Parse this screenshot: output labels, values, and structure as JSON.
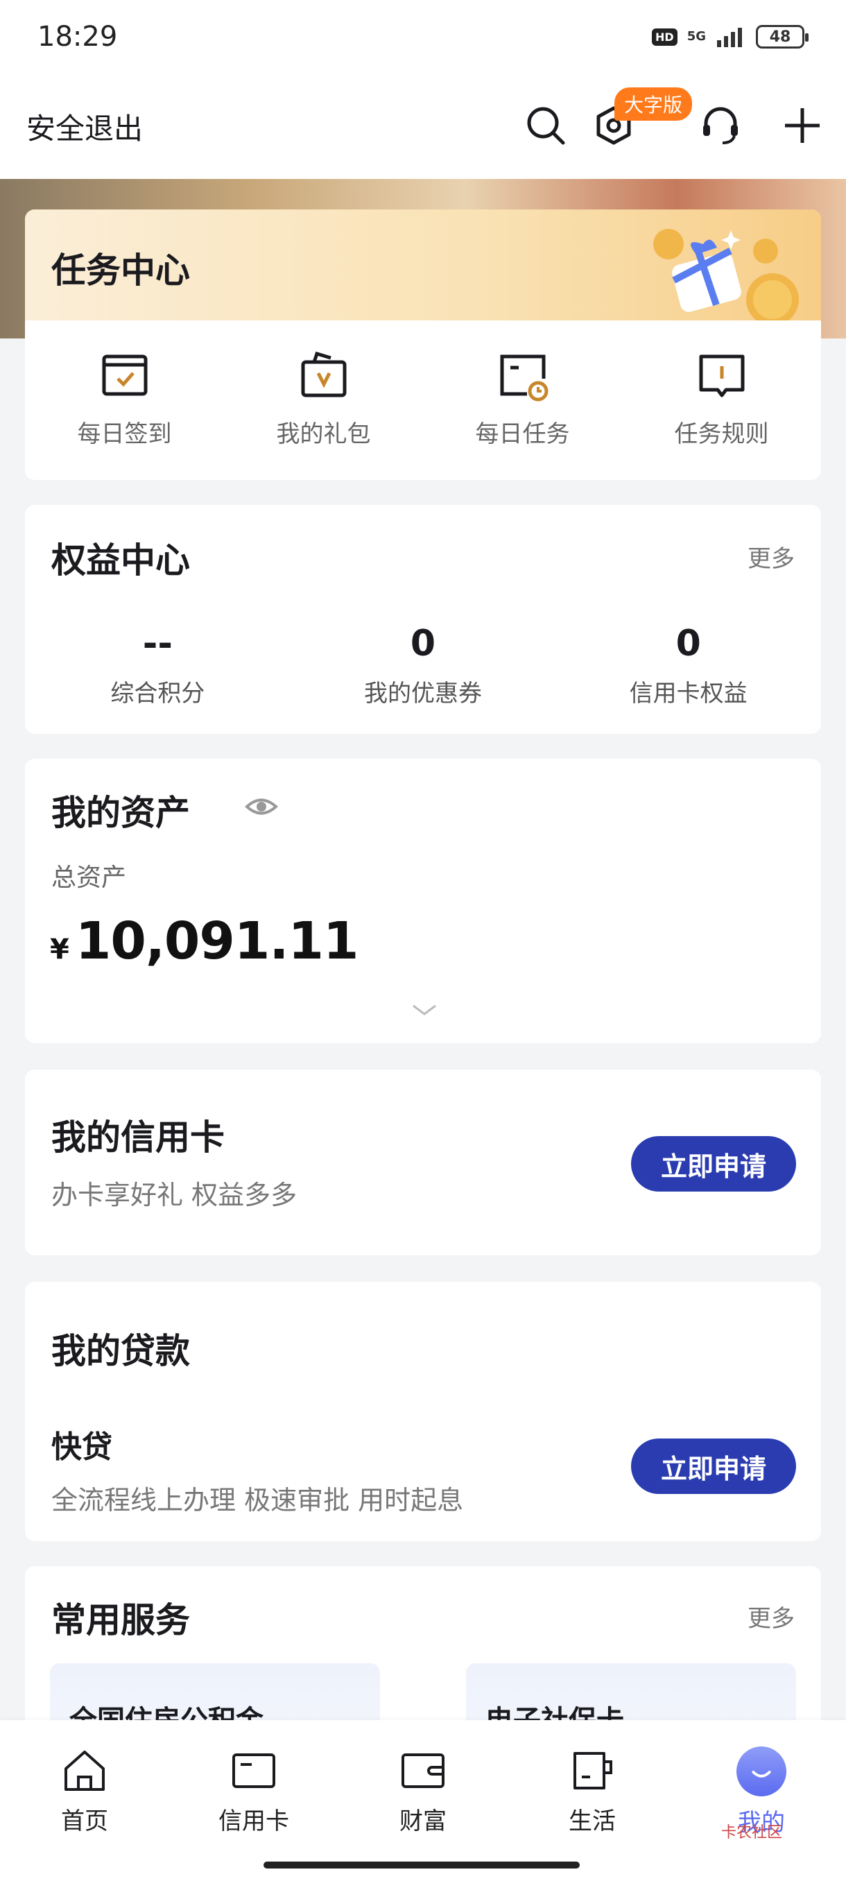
{
  "status_bar": {
    "time": "18:29",
    "hd": "HD",
    "network": "5G",
    "battery": "48"
  },
  "header": {
    "logout_label": "安全退出",
    "large_font_badge": "大字版"
  },
  "task_center": {
    "title": "任务中心",
    "items": [
      {
        "label": "每日签到",
        "icon": "checkin-icon"
      },
      {
        "label": "我的礼包",
        "icon": "gift-package-icon"
      },
      {
        "label": "每日任务",
        "icon": "task-clock-icon"
      },
      {
        "label": "任务规则",
        "icon": "rules-book-icon"
      }
    ]
  },
  "rights_center": {
    "title": "权益中心",
    "more": "更多",
    "stats": [
      {
        "value": "--",
        "label": "综合积分"
      },
      {
        "value": "0",
        "label": "我的优惠券"
      },
      {
        "value": "0",
        "label": "信用卡权益"
      }
    ]
  },
  "assets": {
    "title": "我的资产",
    "total_label": "总资产",
    "currency": "¥",
    "amount": "10,091.11"
  },
  "credit_card": {
    "title": "我的信用卡",
    "subtitle": "办卡享好礼 权益多多",
    "button": "立即申请"
  },
  "loan": {
    "title": "我的贷款",
    "product": "快贷",
    "subtitle": "全流程线上办理 极速审批 用时起息",
    "button": "立即申请"
  },
  "services": {
    "title": "常用服务",
    "more": "更多",
    "items": [
      "全国住房公积金",
      "电子社保卡"
    ]
  },
  "tabbar": {
    "items": [
      {
        "label": "首页",
        "icon": "home-icon"
      },
      {
        "label": "信用卡",
        "icon": "credit-card-icon"
      },
      {
        "label": "财富",
        "icon": "wallet-icon"
      },
      {
        "label": "生活",
        "icon": "cup-icon"
      },
      {
        "label": "我的",
        "icon": "profile-avatar-icon"
      }
    ],
    "active_index": 4
  },
  "watermark": "卡农社区",
  "colors": {
    "primary_button": "#2a3cb0",
    "badge": "#ff7a1a",
    "active_tab": "#5b6bf0",
    "icon_accent": "#c8862a"
  }
}
